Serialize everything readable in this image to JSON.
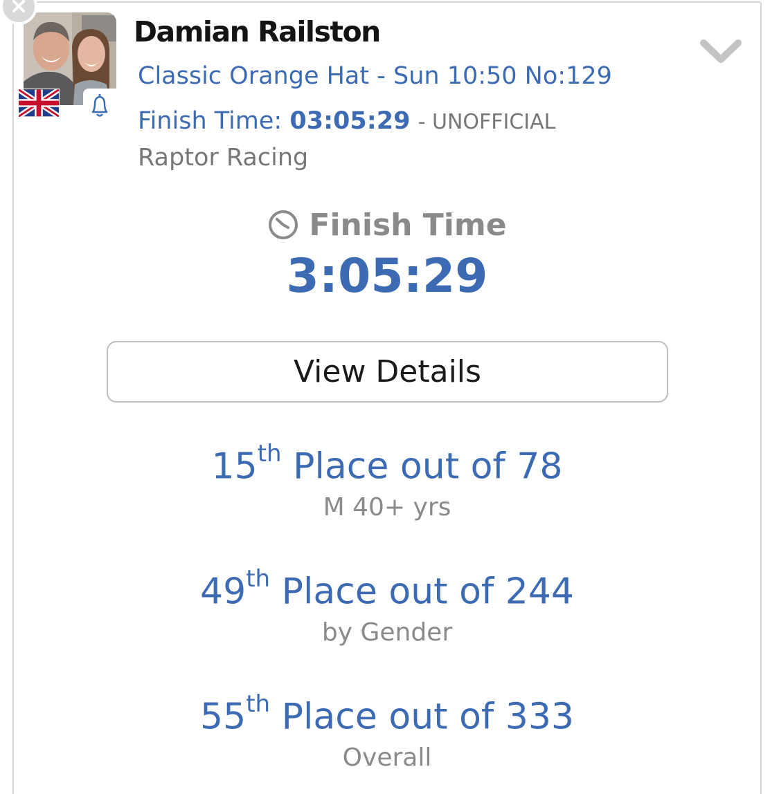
{
  "athlete": {
    "name": "Damian Railston",
    "event_line": "Classic Orange Hat - Sun 10:50 No:129",
    "finish_label": "Finish Time:",
    "finish_time": "03:05:29",
    "finish_status": "- UNOFFICIAL",
    "club": "Raptor Racing",
    "country_flag": "uk-flag-icon"
  },
  "result": {
    "heading": "Finish Time",
    "time": "3:05:29"
  },
  "details_button": "View Details",
  "placings": [
    {
      "rank": "15",
      "suffix": "th",
      "text": "Place out of 78",
      "category": "M 40+ yrs"
    },
    {
      "rank": "49",
      "suffix": "th",
      "text": "Place out of 244",
      "category": "by Gender"
    },
    {
      "rank": "55",
      "suffix": "th",
      "text": "Place out of 333",
      "category": "Overall"
    }
  ],
  "colors": {
    "accent_blue": "#3d6bb3",
    "muted_gray": "#777777",
    "border": "#d4d4d4"
  },
  "icons": [
    "close-icon",
    "bell-icon",
    "chevron-down-icon",
    "clock-icon",
    "uk-flag-icon"
  ]
}
